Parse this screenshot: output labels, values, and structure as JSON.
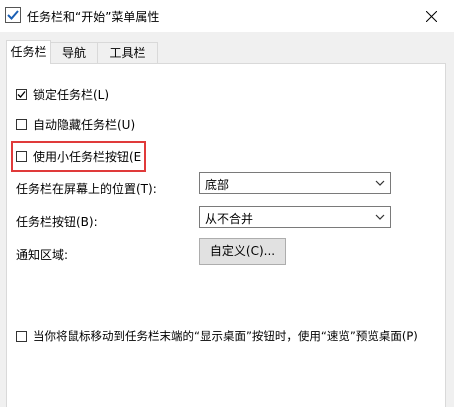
{
  "window": {
    "title": "任务栏和“开始”菜单属性"
  },
  "tabs": [
    {
      "label": "任务栏",
      "active": true
    },
    {
      "label": "导航"
    },
    {
      "label": "工具栏"
    }
  ],
  "options": {
    "lock_taskbar": {
      "label": "锁定任务栏(L)",
      "checked": true
    },
    "auto_hide": {
      "label": "自动隐藏任务栏(U)",
      "checked": false
    },
    "small_buttons": {
      "label": "使用小任务栏按钮(E",
      "checked": false
    },
    "peek": {
      "label": "当你将鼠标移动到任务栏末端的“显示桌面”按钮时，使用“速览”预览桌面(P)",
      "checked": false
    }
  },
  "position": {
    "label": "任务栏在屏幕上的位置(T):",
    "value": "底部"
  },
  "buttons_combine": {
    "label": "任务栏按钮(B):",
    "value": "从不合并"
  },
  "notification": {
    "label": "通知区域:",
    "button": "自定义(C)..."
  },
  "colors": {
    "highlight": "#e03a3a"
  }
}
